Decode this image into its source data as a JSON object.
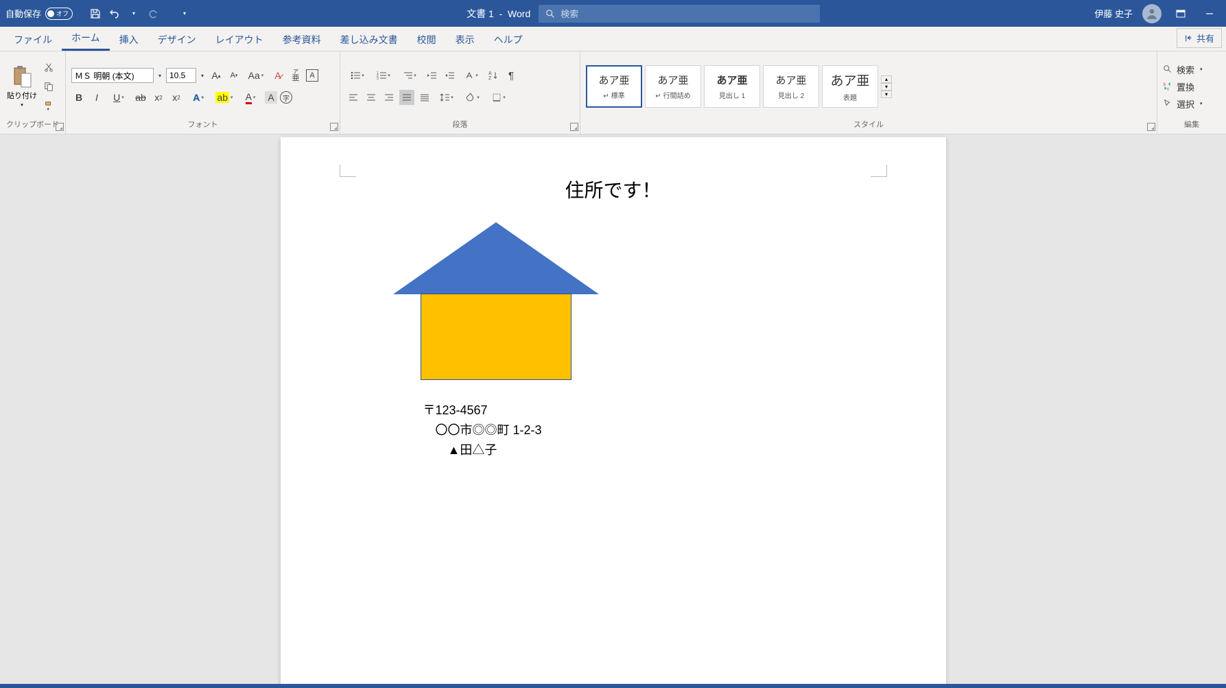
{
  "titlebar": {
    "autosave_label": "自動保存",
    "autosave_state": "オフ",
    "doc_title": "文書 1",
    "app_name": "Word",
    "search_placeholder": "検索",
    "user_name": "伊藤 史子"
  },
  "tabs": {
    "file": "ファイル",
    "home": "ホーム",
    "insert": "挿入",
    "design": "デザイン",
    "layout": "レイアウト",
    "references": "参考資料",
    "mailings": "差し込み文書",
    "review": "校閲",
    "view": "表示",
    "help": "ヘルプ",
    "share": "共有"
  },
  "ribbon": {
    "clipboard": {
      "paste": "貼り付け",
      "label": "クリップボード"
    },
    "font": {
      "name": "ＭＳ 明朝 (本文)",
      "size": "10.5",
      "ruby_top": "ア",
      "ruby_bottom": "亜",
      "label": "フォント"
    },
    "paragraph": {
      "label": "段落"
    },
    "styles": {
      "label": "スタイル",
      "items": [
        {
          "preview": "あア亜",
          "name": "↵ 標準"
        },
        {
          "preview": "あア亜",
          "name": "↵ 行間詰め"
        },
        {
          "preview": "あア亜",
          "name": "見出し 1"
        },
        {
          "preview": "あア亜",
          "name": "見出し 2"
        },
        {
          "preview": "あア亜",
          "name": "表題"
        }
      ]
    },
    "editing": {
      "find": "検索",
      "replace": "置換",
      "select": "選択",
      "label": "編集"
    }
  },
  "document": {
    "heading": "住所です！",
    "postal": "〒123-4567",
    "address": "〇〇市◎◎町 1-2-3",
    "name": "▲田△子"
  }
}
